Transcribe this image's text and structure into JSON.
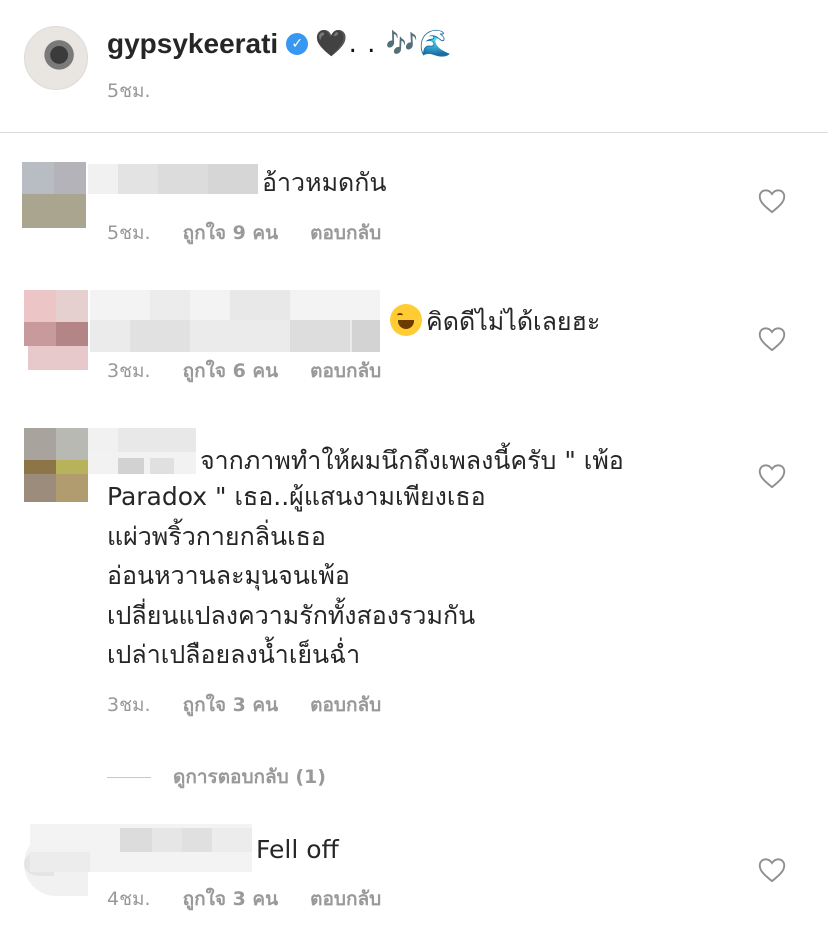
{
  "post": {
    "username": "gypsykeerati",
    "caption": "🖤. . 🎶🌊",
    "time": "5ชม."
  },
  "comments": [
    {
      "text_lines": [
        "อ้าวหมดกัน"
      ],
      "time": "5ชม.",
      "likes": "ถูกใจ 9 คน",
      "reply": "ตอบกลับ"
    },
    {
      "text_lines": [
        "คิดดีไม่ได้เลยฮะ"
      ],
      "time": "3ชม.",
      "likes": "ถูกใจ 6 คน",
      "reply": "ตอบกลับ"
    },
    {
      "text_lines": [
        "จากภาพทำให้ผมนึกถึงเพลงนี้ครับ \" เพ้อ",
        "Paradox \" เธอ..ผู้แสนงามเพียงเธอ",
        "แผ่วพริ้วกายกลิ่นเธอ",
        "อ่อนหวานละมุนจนเพ้อ",
        "เปลี่ยนแปลงความรักทั้งสองรวมกัน",
        "เปล่าเปลือยลงน้ำเย็นฉ่ำ"
      ],
      "time": "3ชม.",
      "likes": "ถูกใจ 3 คน",
      "reply": "ตอบกลับ",
      "view_replies": "ดูการตอบกลับ (1)"
    },
    {
      "text_lines": [
        "Fell off"
      ],
      "time": "4ชม.",
      "likes": "ถูกใจ 3 คน",
      "reply": "ตอบกลับ"
    }
  ],
  "icons": {
    "verified": "verified-badge-icon",
    "heart": "heart-outline-icon",
    "emoji": "face-with-tears-of-joy-icon"
  },
  "colors": {
    "text": "#262626",
    "muted": "#999999",
    "verified": "#3897f0",
    "divider": "#dbdbdb"
  }
}
